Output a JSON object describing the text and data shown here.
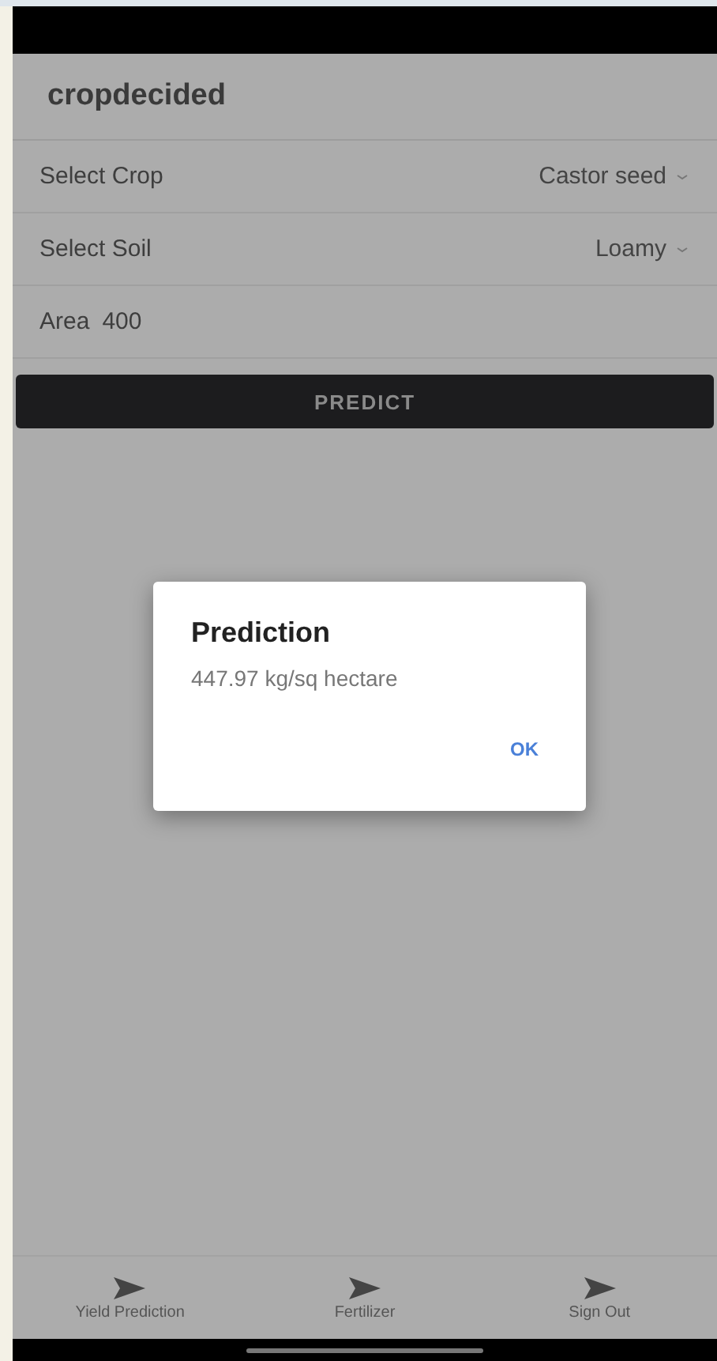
{
  "app_bar": {
    "title": "cropdecided"
  },
  "form": {
    "rows": [
      {
        "kind": "select",
        "label": "Select Crop",
        "value": "Castor seed"
      },
      {
        "kind": "select",
        "label": "Select Soil",
        "value": "Loamy"
      },
      {
        "kind": "input",
        "label": "Area",
        "value": "400"
      }
    ],
    "button": "PREDICT"
  },
  "dialog": {
    "title": "Prediction",
    "message": "447.97 kg/sq hectare",
    "button": "OK"
  },
  "bottom_nav": [
    {
      "label": "Yield Prediction"
    },
    {
      "label": "Fertilizer"
    },
    {
      "label": "Sign Out"
    }
  ]
}
